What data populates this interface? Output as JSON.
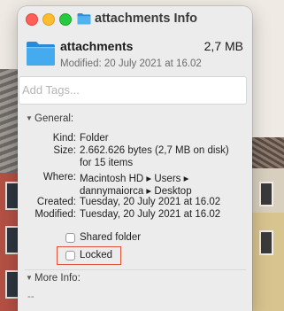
{
  "window": {
    "title": "attachments Info"
  },
  "header": {
    "name": "attachments",
    "size": "2,7 MB",
    "modified": "Modified: 20 July 2021 at 16.02"
  },
  "tags": {
    "placeholder": "Add Tags..."
  },
  "general": {
    "heading": "General:",
    "rows": [
      {
        "label": "Kind:",
        "value": "Folder"
      },
      {
        "label": "Size:",
        "value": "2.662.626 bytes (2,7 MB on disk)",
        "value2": "for 15 items"
      },
      {
        "label": "Where:",
        "value": "Macintosh HD ▸ Users ▸",
        "value2": "dannymaiorca ▸ Desktop"
      },
      {
        "label": "Created:",
        "value": "Tuesday, 20 July 2021 at 16.02"
      },
      {
        "label": "Modified:",
        "value": "Tuesday, 20 July 2021 at 16.02"
      }
    ],
    "shared_folder_label": "Shared folder",
    "locked_label": "Locked"
  },
  "more_info": {
    "heading": "More Info:",
    "placeholder": "--"
  },
  "icons": {
    "close": "close-icon",
    "minimize": "minimize-icon",
    "maximize": "maximize-icon",
    "folder": "folder-icon",
    "chevron": "chevron-down-icon"
  },
  "colors": {
    "folder_blue": "#3aa6e8",
    "highlight": "#e0533a"
  }
}
